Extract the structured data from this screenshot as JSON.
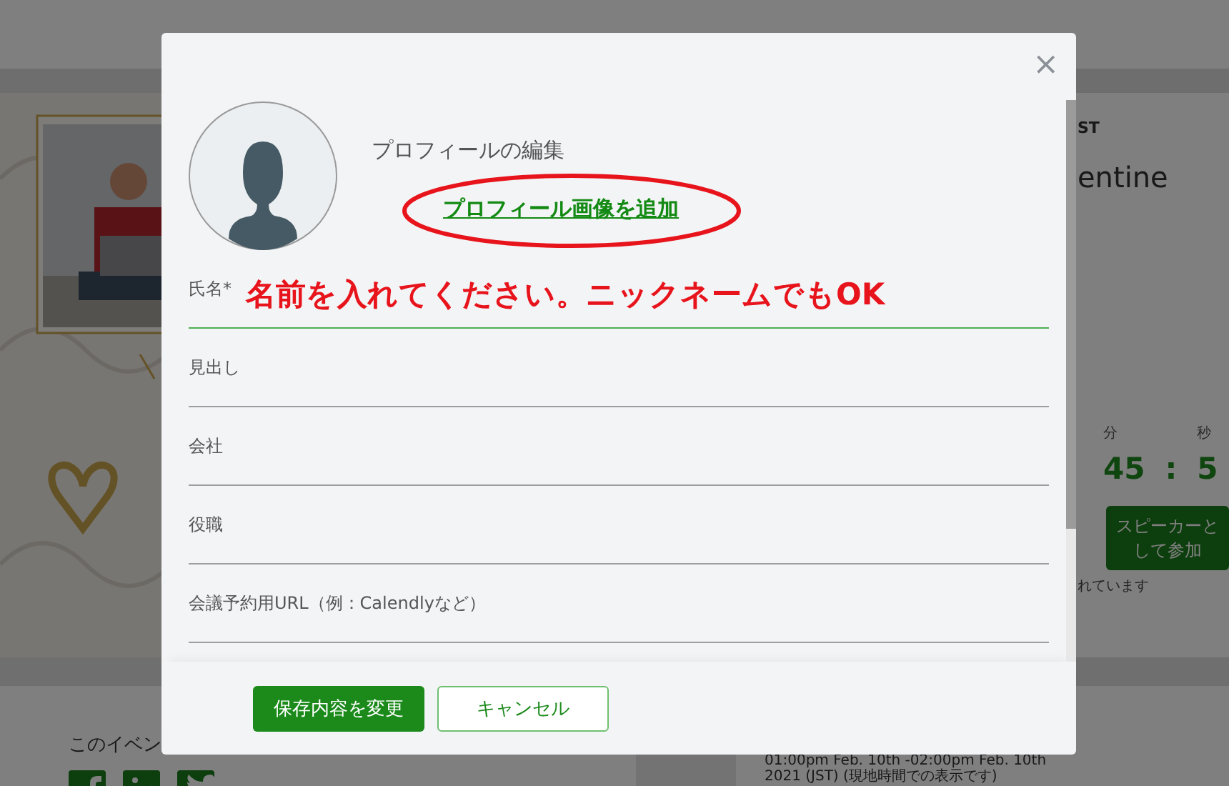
{
  "background": {
    "date_fragment": "ST",
    "title_fragment": "entine",
    "countdown": [
      {
        "unit": "分",
        "value": "45"
      },
      {
        "unit": "秒",
        "value": "5"
      }
    ],
    "countdown_separator": ":",
    "speaker_button": "スピーカーとして参加",
    "note_fragment": "れています",
    "share_fragment": "このイベン",
    "schedule": [
      "01:00pm Feb. 10th -02:00pm Feb. 10th",
      "2021 (JST) (現地時間での表示です)"
    ]
  },
  "modal": {
    "close": "×",
    "heading": "プロフィールの編集",
    "add_photo_link": "プロフィール画像を追加",
    "fields": [
      {
        "label": "氏名*",
        "focused": true,
        "annotation": "名前を入れてください。ニックネームでもOK"
      },
      {
        "label": "見出し",
        "focused": false
      },
      {
        "label": "会社",
        "focused": false
      },
      {
        "label": "役職",
        "focused": false
      },
      {
        "label": "会議予約用URL（例：Calendlyなど）",
        "focused": false
      }
    ],
    "buttons": [
      {
        "label": "保存内容を変更",
        "kind": "primary"
      },
      {
        "label": "キャンセル",
        "kind": "secondary"
      }
    ]
  },
  "link_annotation": {
    "kind": "ellipse"
  }
}
